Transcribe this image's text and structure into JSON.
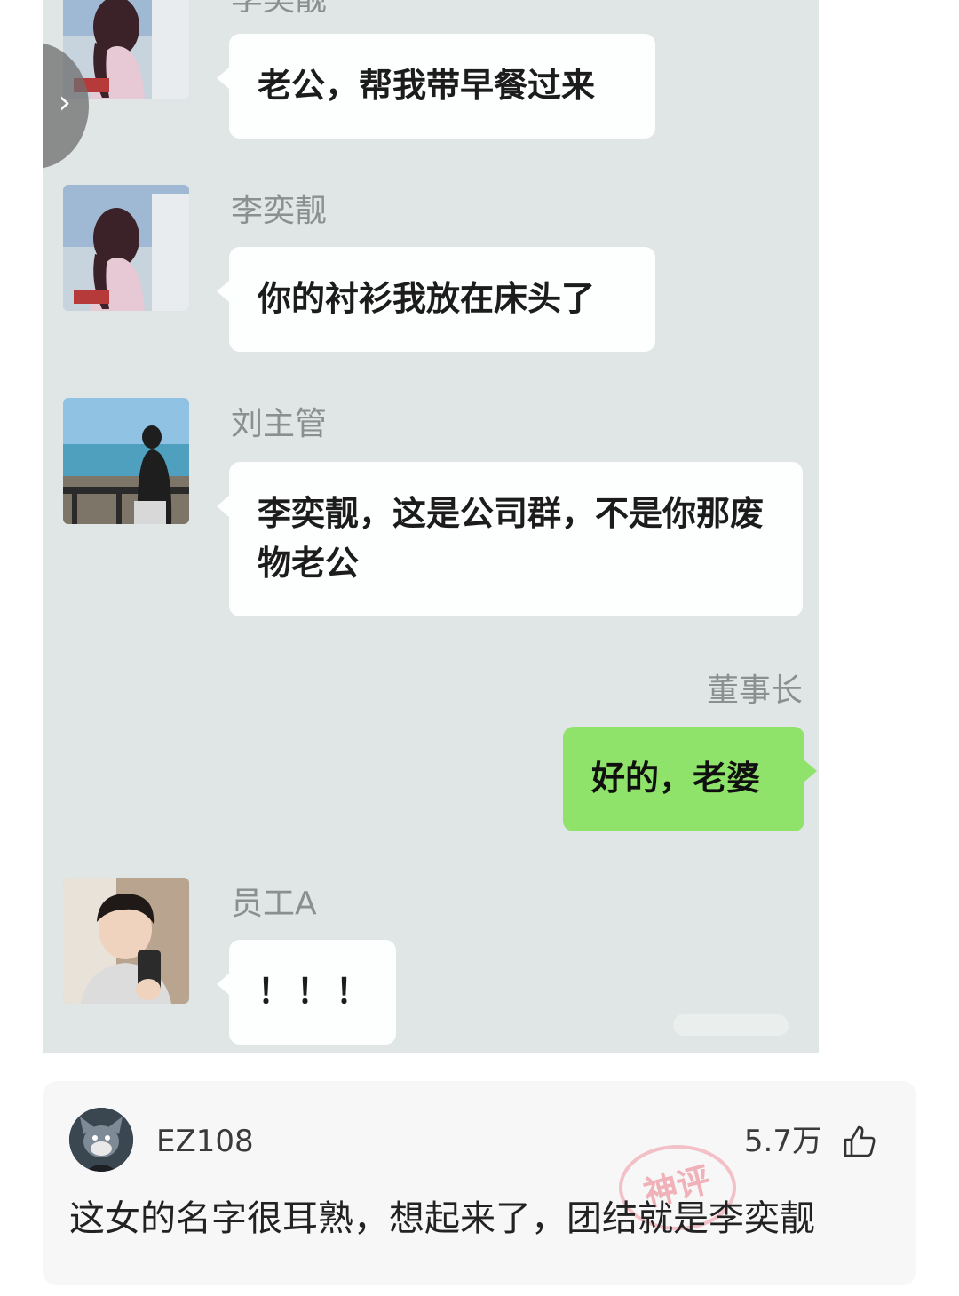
{
  "chat": {
    "messages": [
      {
        "sender": "李奕靓",
        "text": "老公，帮我带早餐过来"
      },
      {
        "sender": "李奕靓",
        "text": "你的衬衫我放在床头了"
      },
      {
        "sender": "刘主管",
        "text": "李奕靓，这是公司群，不是你那废物老公"
      },
      {
        "sender": "董事长",
        "text": "好的，老婆"
      },
      {
        "sender": "员工A",
        "text": "！！！"
      }
    ],
    "nav_glyph": "›"
  },
  "comment": {
    "username": "EZ108",
    "likes": "5.7万",
    "text": "这女的名字很耳熟，想起来了，团结就是李奕靓",
    "stamp_text": "神评"
  },
  "colors": {
    "chat_bg": "#dfe6e5",
    "bubble_white": "#fdfefe",
    "bubble_green": "#8fe36a",
    "stamp": "#e85a6a"
  }
}
